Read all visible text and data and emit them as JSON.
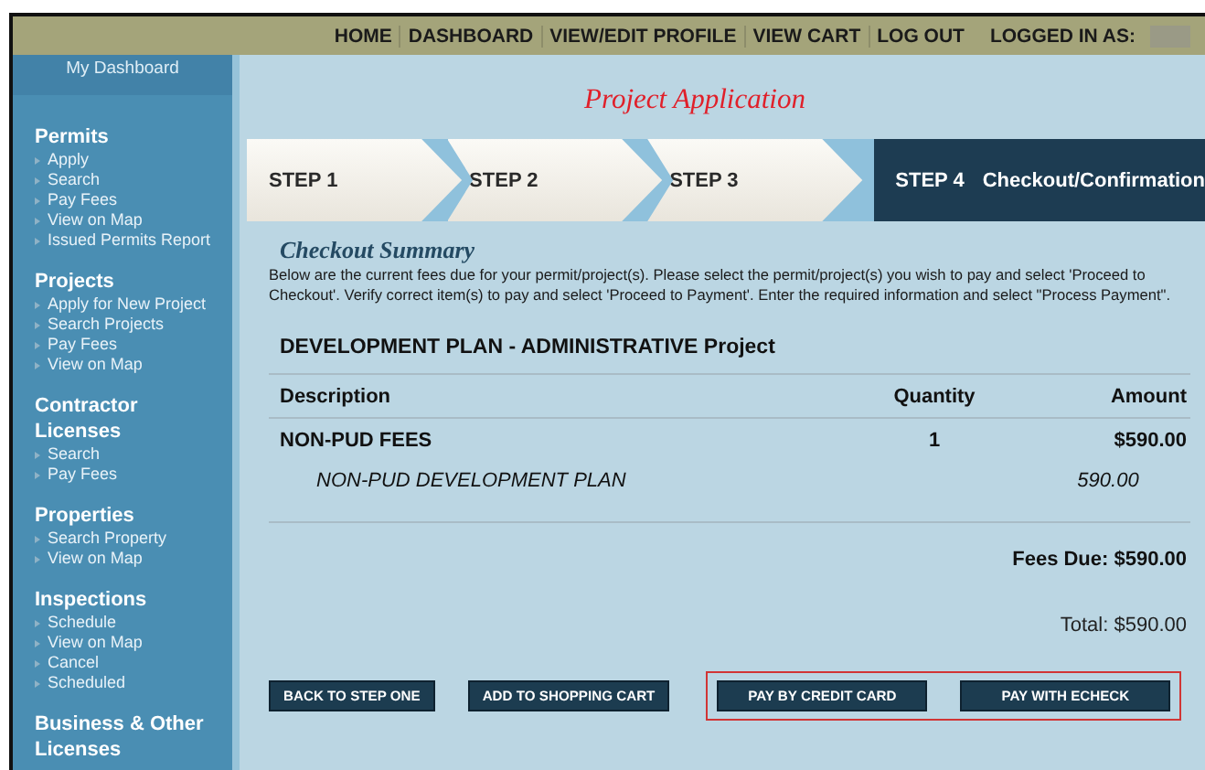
{
  "top_nav": {
    "links": [
      "HOME",
      "DASHBOARD",
      "VIEW/EDIT PROFILE",
      "VIEW CART",
      "LOG OUT"
    ],
    "logged_in_label": "LOGGED IN AS:"
  },
  "sidebar": {
    "dashboard": "My Dashboard",
    "sections": [
      {
        "title": "Permits",
        "items": [
          "Apply",
          "Search",
          "Pay Fees",
          "View on Map",
          "Issued Permits Report"
        ]
      },
      {
        "title": "Projects",
        "items": [
          "Apply for New Project",
          "Search Projects",
          "Pay Fees",
          "View on Map"
        ]
      },
      {
        "title": "Contractor Licenses",
        "items": [
          "Search",
          "Pay Fees"
        ]
      },
      {
        "title": "Properties",
        "items": [
          "Search Property",
          "View on Map"
        ]
      },
      {
        "title": "Inspections",
        "items": [
          "Schedule",
          "View on Map",
          "Cancel",
          "Scheduled"
        ]
      },
      {
        "title": "Business & Other Licenses"
      }
    ]
  },
  "page_title": "Project Application",
  "steps": [
    {
      "label": "STEP 1",
      "selected": false
    },
    {
      "label": "STEP 2",
      "selected": false
    },
    {
      "label": "STEP 3",
      "selected": false
    },
    {
      "label": "STEP 4",
      "caption": "Checkout/Confirmation",
      "selected": true
    }
  ],
  "summary": {
    "title": "Checkout Summary",
    "text": "Below are the current fees due for your permit/project(s). Please select the permit/project(s) you wish to pay and select 'Proceed to Checkout'. Verify correct item(s) to pay and select 'Proceed to Payment'. Enter the required information and select \"Process Payment\"."
  },
  "project": {
    "title": "DEVELOPMENT PLAN - ADMINISTRATIVE Project",
    "columns": [
      "Description",
      "Quantity",
      "Amount"
    ],
    "rows": [
      {
        "kind": "group",
        "description": "NON-PUD FEES",
        "quantity": "1",
        "amount": "$590.00"
      },
      {
        "kind": "item",
        "description": "NON-PUD DEVELOPMENT PLAN",
        "amount": "590.00"
      }
    ],
    "fees_due": "Fees Due: $590.00",
    "total": "Total: $590.00"
  },
  "actions": [
    {
      "label": "BACK TO STEP ONE",
      "highlighted": false
    },
    {
      "label": "ADD TO SHOPPING CART",
      "highlighted": false
    },
    {
      "label": "PAY BY CREDIT CARD",
      "highlighted": true
    },
    {
      "label": "PAY WITH ECHECK",
      "highlighted": true
    }
  ]
}
